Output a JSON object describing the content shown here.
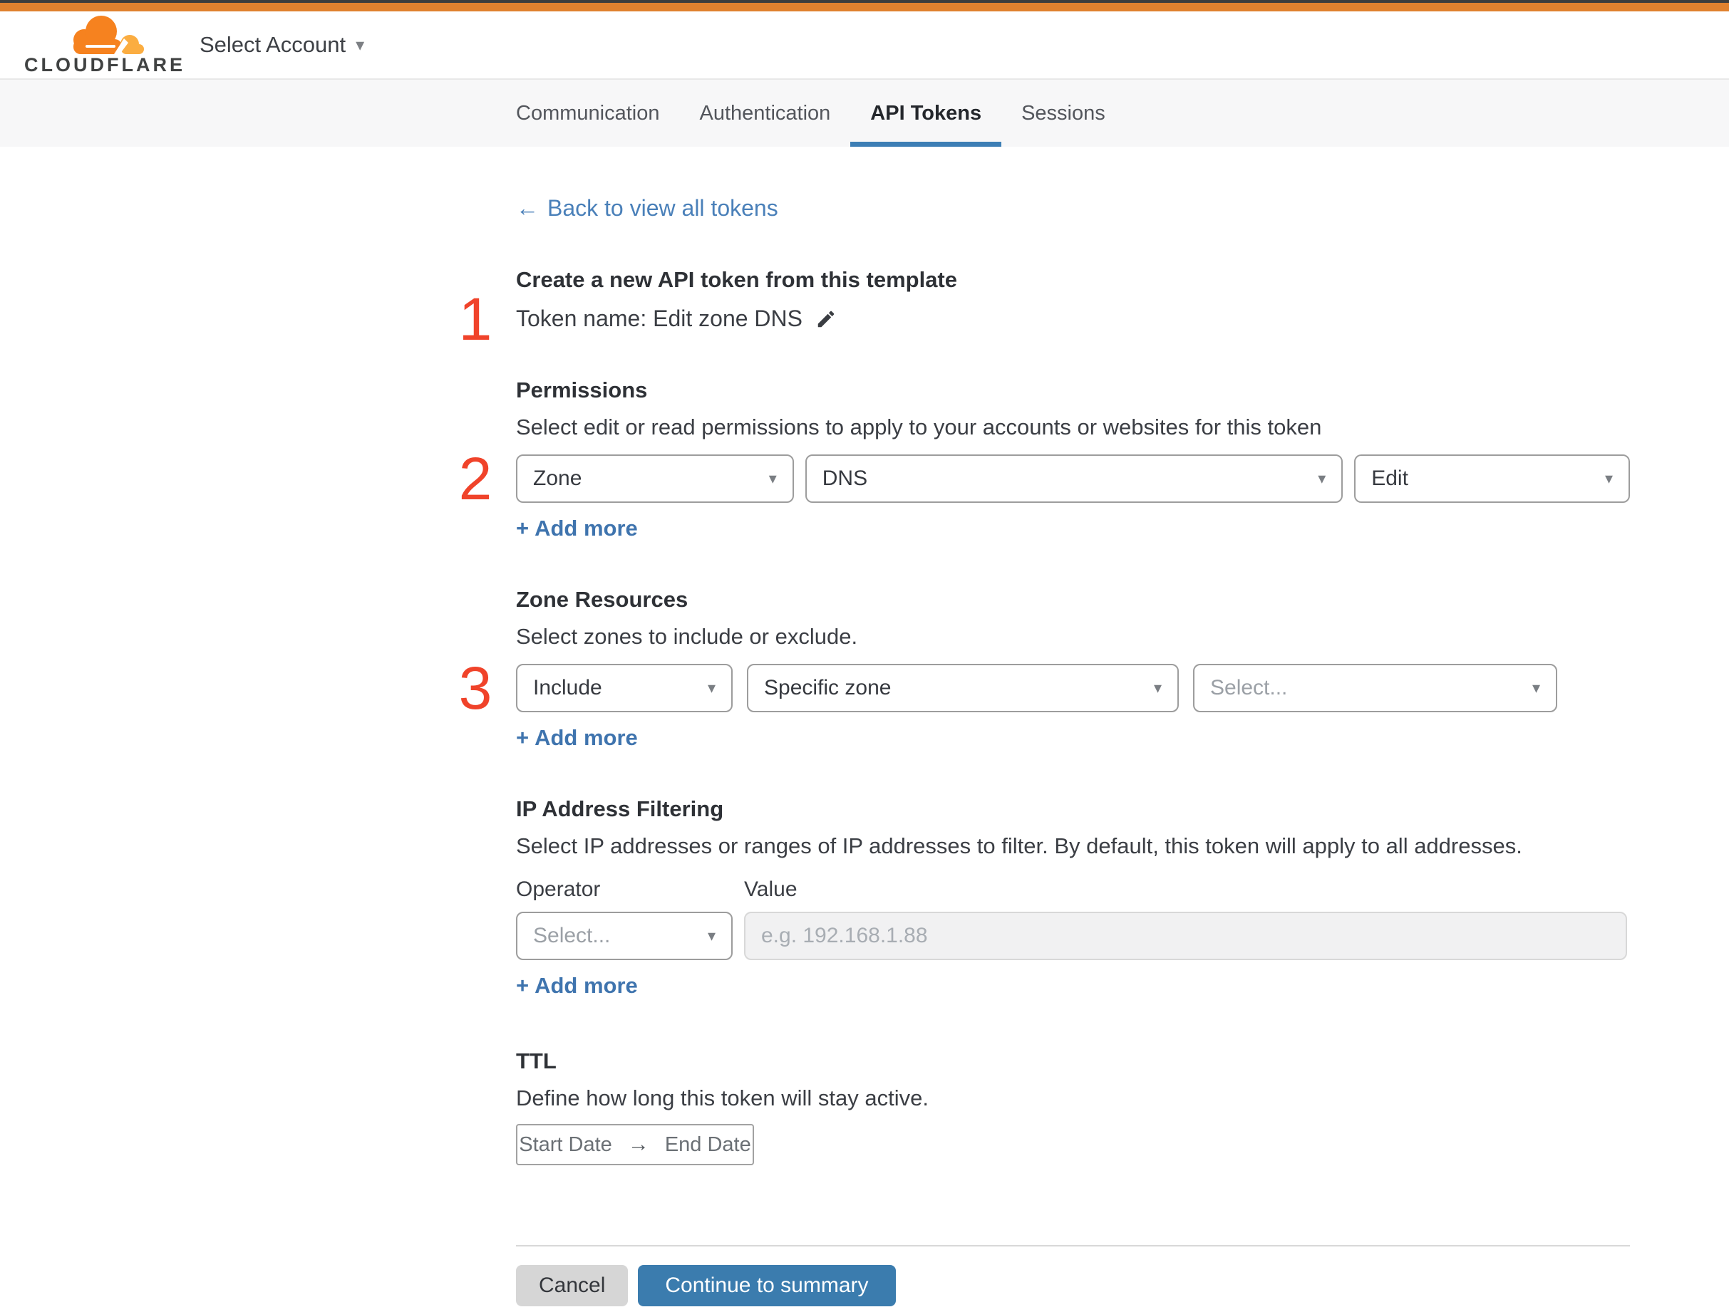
{
  "ui": {
    "caret_down": "▾",
    "plus": "+",
    "arrow_left": "←",
    "arrow_right": "→"
  },
  "colors": {
    "accent_orange": "#e0812f",
    "brand_orange": "#f6821f",
    "brand_orange_light": "#fbad41",
    "link_blue": "#4a80b9",
    "active_tab_blue": "#3c7eb5",
    "step_red": "#f0432a",
    "button_blue": "#3b7cae"
  },
  "header": {
    "brand": "CLOUDFLARE",
    "account_selector": "Select Account"
  },
  "tabs": [
    {
      "label": "Communication",
      "active": false
    },
    {
      "label": "Authentication",
      "active": false
    },
    {
      "label": "API Tokens",
      "active": true
    },
    {
      "label": "Sessions",
      "active": false
    }
  ],
  "back_link": {
    "label": "Back to view all tokens"
  },
  "token_section": {
    "step": "1",
    "heading": "Create a new API token from this template",
    "name_line": "Token name: Edit zone DNS"
  },
  "permissions": {
    "step": "2",
    "heading": "Permissions",
    "description": "Select edit or read permissions to apply to your accounts or websites for this token",
    "scope": "Zone",
    "resource": "DNS",
    "access": "Edit",
    "add_more": "Add more"
  },
  "zone_resources": {
    "step": "3",
    "heading": "Zone Resources",
    "description": "Select zones to include or exclude.",
    "mode": "Include",
    "type": "Specific zone",
    "zone_placeholder": "Select...",
    "add_more": "Add more"
  },
  "ip_filtering": {
    "heading": "IP Address Filtering",
    "description": "Select IP addresses or ranges of IP addresses to filter. By default, this token will apply to all addresses.",
    "operator_label": "Operator",
    "value_label": "Value",
    "operator_placeholder": "Select...",
    "value_placeholder": "e.g. 192.168.1.88",
    "add_more": "Add more"
  },
  "ttl": {
    "heading": "TTL",
    "description": "Define how long this token will stay active.",
    "start": "Start Date",
    "end": "End Date"
  },
  "footer": {
    "cancel": "Cancel",
    "continue": "Continue to summary"
  }
}
